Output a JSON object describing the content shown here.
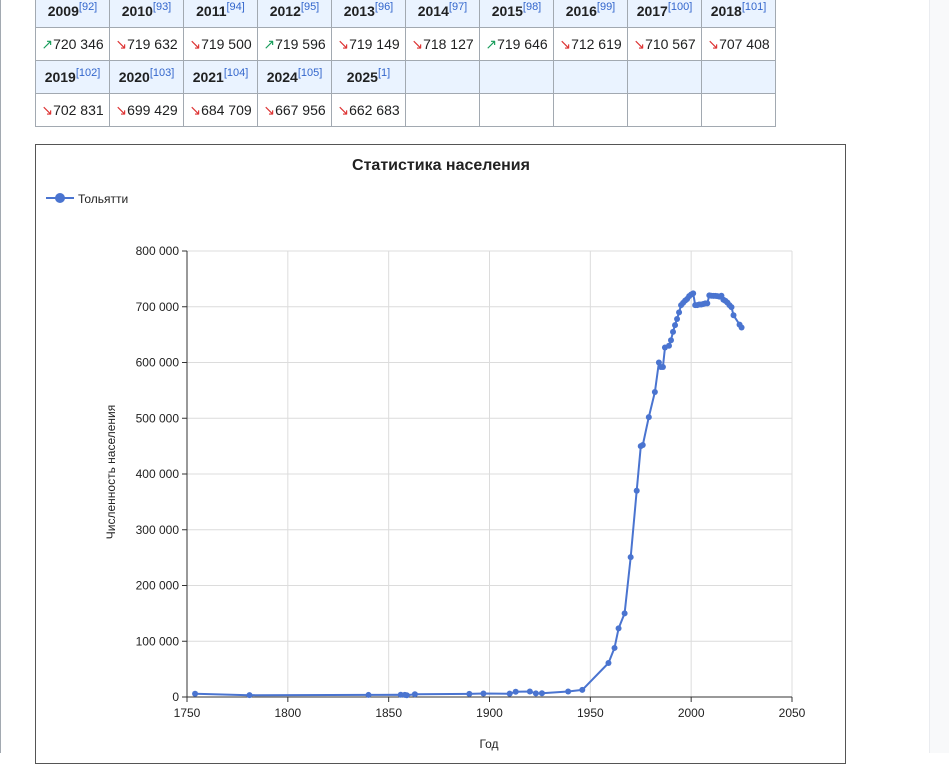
{
  "table": {
    "header_row_1": [
      {
        "year": "2009",
        "ref": "[92]"
      },
      {
        "year": "2010",
        "ref": "[93]"
      },
      {
        "year": "2011",
        "ref": "[94]"
      },
      {
        "year": "2012",
        "ref": "[95]"
      },
      {
        "year": "2013",
        "ref": "[96]"
      },
      {
        "year": "2014",
        "ref": "[97]"
      },
      {
        "year": "2015",
        "ref": "[98]"
      },
      {
        "year": "2016",
        "ref": "[99]"
      },
      {
        "year": "2017",
        "ref": "[100]"
      },
      {
        "year": "2018",
        "ref": "[101]"
      }
    ],
    "value_row_1": [
      {
        "trend": "up",
        "arrow": "↗",
        "value": "720 346"
      },
      {
        "trend": "down",
        "arrow": "↘",
        "value": "719 632"
      },
      {
        "trend": "down",
        "arrow": "↘",
        "value": "719 500"
      },
      {
        "trend": "up",
        "arrow": "↗",
        "value": "719 596"
      },
      {
        "trend": "down",
        "arrow": "↘",
        "value": "719 149"
      },
      {
        "trend": "down",
        "arrow": "↘",
        "value": "718 127"
      },
      {
        "trend": "up",
        "arrow": "↗",
        "value": "719 646"
      },
      {
        "trend": "down",
        "arrow": "↘",
        "value": "712 619"
      },
      {
        "trend": "down",
        "arrow": "↘",
        "value": "710 567"
      },
      {
        "trend": "down",
        "arrow": "↘",
        "value": "707 408"
      }
    ],
    "header_row_2": [
      {
        "year": "2019",
        "ref": "[102]"
      },
      {
        "year": "2020",
        "ref": "[103]"
      },
      {
        "year": "2021",
        "ref": "[104]"
      },
      {
        "year": "2024",
        "ref": "[105]"
      },
      {
        "year": "2025",
        "ref": "[1]"
      },
      {
        "year": "",
        "ref": ""
      },
      {
        "year": "",
        "ref": ""
      },
      {
        "year": "",
        "ref": ""
      },
      {
        "year": "",
        "ref": ""
      },
      {
        "year": "",
        "ref": ""
      }
    ],
    "value_row_2": [
      {
        "trend": "down",
        "arrow": "↘",
        "value": "702 831"
      },
      {
        "trend": "down",
        "arrow": "↘",
        "value": "699 429"
      },
      {
        "trend": "down",
        "arrow": "↘",
        "value": "684 709"
      },
      {
        "trend": "down",
        "arrow": "↘",
        "value": "667 956"
      },
      {
        "trend": "down",
        "arrow": "↘",
        "value": "662 683"
      },
      {
        "trend": "",
        "arrow": "",
        "value": ""
      },
      {
        "trend": "",
        "arrow": "",
        "value": ""
      },
      {
        "trend": "",
        "arrow": "",
        "value": ""
      },
      {
        "trend": "",
        "arrow": "",
        "value": ""
      },
      {
        "trend": "",
        "arrow": "",
        "value": ""
      }
    ]
  },
  "colors": {
    "up": "#1a9e5c",
    "down": "#d33",
    "series": "#4a74d0",
    "header_bg": "#eaf3ff",
    "link": "#3366cc"
  },
  "chart_data": {
    "type": "line",
    "title": "Статистика населения",
    "xlabel": "Год",
    "ylabel": "Численность населения",
    "xlim": [
      1750,
      2050
    ],
    "ylim": [
      0,
      800000
    ],
    "xticks": [
      "1750",
      "1800",
      "1850",
      "1900",
      "1950",
      "2000",
      "2050"
    ],
    "yticks": [
      "0",
      "100 000",
      "200 000",
      "300 000",
      "400 000",
      "500 000",
      "600 000",
      "700 000",
      "800 000"
    ],
    "grid": true,
    "legend": "top-left",
    "series": [
      {
        "name": "Тольятти",
        "x": [
          1754,
          1781,
          1840,
          1856,
          1858,
          1859,
          1863,
          1890,
          1897,
          1910,
          1913,
          1920,
          1923,
          1926,
          1939,
          1946,
          1959,
          1962,
          1964,
          1967,
          1970,
          1973,
          1975,
          1976,
          1979,
          1982,
          1984,
          1985,
          1986,
          1987,
          1989,
          1990,
          1991,
          1992,
          1993,
          1994,
          1995,
          1996,
          1997,
          1998,
          1999,
          2000,
          2001,
          2002,
          2003,
          2004,
          2005,
          2006,
          2007,
          2008,
          2009,
          2010,
          2011,
          2012,
          2013,
          2014,
          2015,
          2016,
          2017,
          2018,
          2019,
          2020,
          2021,
          2024,
          2025
        ],
        "y": [
          5900,
          3300,
          3700,
          4100,
          3800,
          3100,
          4900,
          5600,
          6200,
          6000,
          9400,
          9800,
          6400,
          6800,
          9800,
          12800,
          61000,
          88000,
          123000,
          150000,
          251000,
          370000,
          450000,
          452000,
          502000,
          547000,
          600000,
          592000,
          592000,
          627000,
          630000,
          640000,
          655000,
          667000,
          678000,
          690000,
          703000,
          707000,
          711000,
          714000,
          719000,
          722000,
          724000,
          703000,
          703000,
          704000,
          704000,
          705000,
          706000,
          706000,
          720346,
          719632,
          719500,
          719596,
          719149,
          718127,
          719646,
          712619,
          710567,
          707408,
          702831,
          699429,
          684709,
          667956,
          662683
        ]
      }
    ]
  }
}
